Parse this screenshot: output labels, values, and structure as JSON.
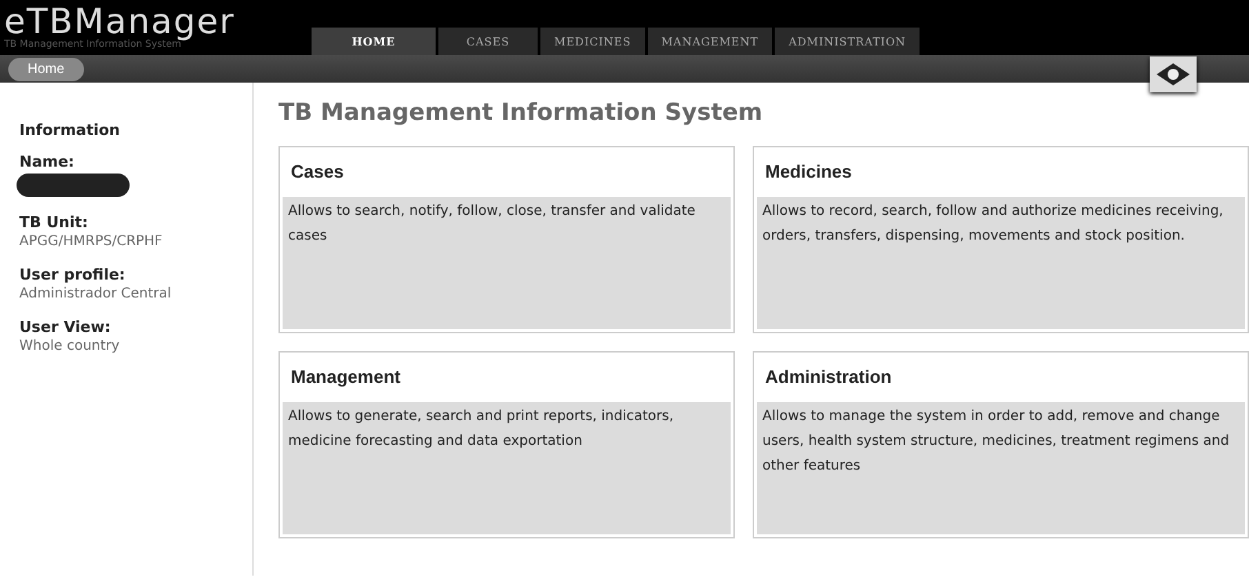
{
  "logo": {
    "title": "eTBManager",
    "subtitle": "TB Management Information System"
  },
  "tabs": [
    {
      "label": "HOME",
      "selected": true
    },
    {
      "label": "CASES",
      "selected": false
    },
    {
      "label": "MEDICINES",
      "selected": false
    },
    {
      "label": "MANAGEMENT",
      "selected": false
    },
    {
      "label": "ADMINISTRATION",
      "selected": false
    }
  ],
  "breadcrumb": "Home",
  "sidebar": {
    "heading": "Information",
    "fields": [
      {
        "label": "Name:",
        "redacted": true
      },
      {
        "label": "TB Unit:",
        "value": "APGG/HMRPS/CRPHF"
      },
      {
        "label": "User profile:",
        "value": "Administrador Central"
      },
      {
        "label": "User View:",
        "value": "Whole country"
      }
    ]
  },
  "page_title": "TB Management Information System",
  "cards": [
    {
      "title": "Cases",
      "description": "Allows to search, notify, follow, close, transfer and validate cases"
    },
    {
      "title": "Medicines",
      "description": "Allows to record, search, follow and authorize medicines receiving, orders, transfers, dispensing, movements and stock position."
    },
    {
      "title": "Management",
      "description": "Allows to generate, search and print reports, indicators, medicine forecasting and data exportation"
    },
    {
      "title": "Administration",
      "description": "Allows to manage the system in order to add, remove and change users, health system structure, medicines, treatment regimens and other features"
    }
  ]
}
